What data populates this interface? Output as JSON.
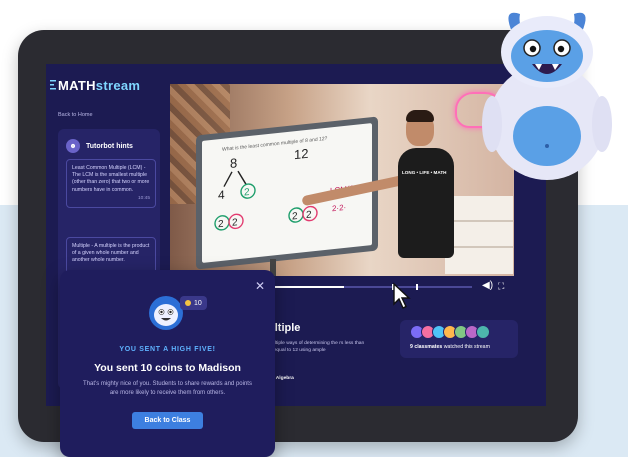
{
  "app": {
    "logo_text_a": "MATH",
    "logo_text_b": "stream",
    "back_link": "Back to Home"
  },
  "tutorbot": {
    "title": "Tutorbot hints",
    "hints": [
      {
        "text": "Least Common Multiple (LCM) - The LCM is the smallest multiple (other than zero) that two or more numbers have in common.",
        "time": "10:45"
      },
      {
        "text": "Multiple - A multiple is the product of a given whole number and another whole number."
      }
    ]
  },
  "video": {
    "board_question": "What is the least common multiple of 8 and 12?",
    "shirt_text": "LONG • LIFE • MATH",
    "progress": 0.56
  },
  "topic": {
    "title_fragment": "ultiple",
    "description": "multiple ways of determining the rs less than or equal to 12 using ample",
    "course": "for Algebra"
  },
  "classmates": {
    "count": "9 classmates",
    "suffix": " watched this stream",
    "avatar_colors": [
      "#7b6cf6",
      "#f56fa1",
      "#4fc3f7",
      "#ffb74d",
      "#81c784",
      "#ba68c8",
      "#4db6ac"
    ]
  },
  "popup": {
    "close_icon": "close-icon",
    "coin_count": "10",
    "eyebrow": "YOU SENT A HIGH FIVE!",
    "title": "You sent 10 coins to Madison",
    "body": "That's mighty nice of you. Students to share rewards and points are more likely to receive them from others.",
    "button": "Back to Class"
  },
  "colors": {
    "screen_bg": "#1c1b52",
    "panel": "#262467",
    "accent_blue": "#3d7fe0",
    "eyebrow_blue": "#5fb3ff",
    "coin": "#f5c342"
  }
}
